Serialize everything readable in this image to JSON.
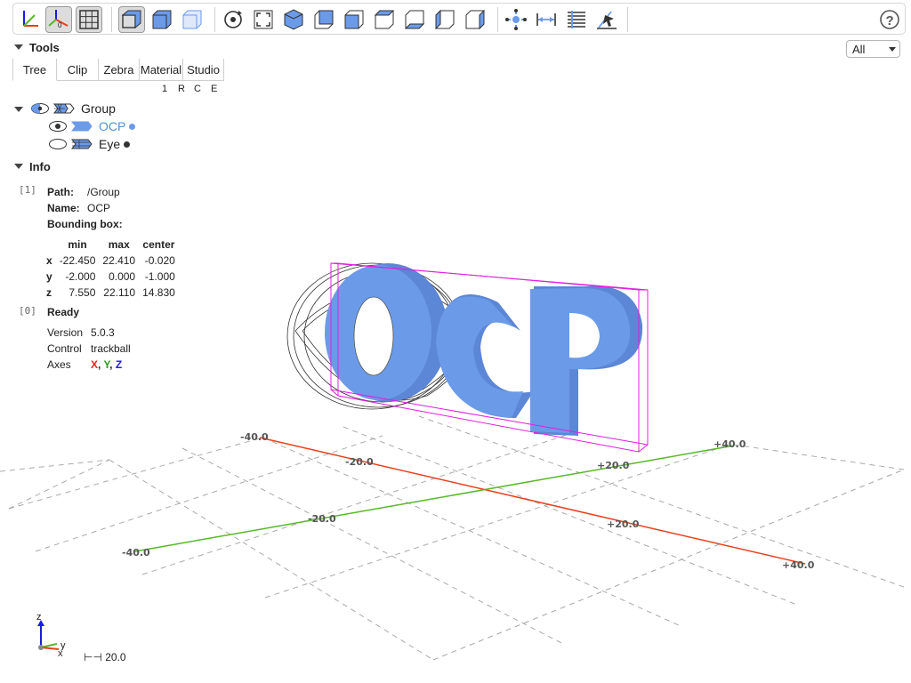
{
  "toolbar": {
    "buttons": [
      "axes",
      "axes0",
      "grid",
      "perspective",
      "ortho-cube",
      "transparent",
      "reset",
      "resize",
      "iso",
      "front",
      "rear",
      "top",
      "bottom",
      "left",
      "right",
      "explode",
      "measure-distance",
      "measure-properties",
      "select",
      "help"
    ],
    "active": [
      "axes0",
      "grid",
      "perspective"
    ]
  },
  "filter": {
    "value": "All"
  },
  "tools": {
    "title": "Tools",
    "tabs": [
      "Tree",
      "Clip",
      "Zebra",
      "Material",
      "Studio"
    ],
    "active_tab": "Tree",
    "tree_options": [
      "1",
      "R",
      "C",
      "E"
    ]
  },
  "tree": {
    "group": {
      "label": "Group"
    },
    "items": [
      {
        "label": "OCP",
        "color": "#6b9ae8",
        "selected": true
      },
      {
        "label": "Eye",
        "color": "#333333",
        "selected": false
      }
    ]
  },
  "info": {
    "title": "Info",
    "entry1": {
      "index": "[1]",
      "path_label": "Path:",
      "path": "/Group",
      "name_label": "Name:",
      "name": "OCP",
      "bbox_label": "Bounding box:",
      "headers": [
        "min",
        "max",
        "center"
      ],
      "rows": [
        {
          "axis": "x",
          "min": "-22.450",
          "max": "22.410",
          "center": "-0.020"
        },
        {
          "axis": "y",
          "min": "-2.000",
          "max": "0.000",
          "center": "-1.000"
        },
        {
          "axis": "z",
          "min": "7.550",
          "max": "22.110",
          "center": "14.830"
        }
      ]
    },
    "entry0": {
      "index": "[0]",
      "status": "Ready",
      "version_label": "Version",
      "version": "5.0.3",
      "control_label": "Control",
      "control": "trackball",
      "axes_label": "Axes",
      "axis_x": "X",
      "axis_y": "Y",
      "axis_z": "Z",
      "axis_sep": ", "
    }
  },
  "viewport": {
    "ticks": {
      "x_axis": [
        "-40.0",
        "-20.0",
        "+20.0",
        "+40.0"
      ],
      "y_axis": [
        "-40.0",
        "-20.0",
        "+20.0",
        "+40.0"
      ]
    },
    "model_text": "OCP",
    "axis_colors": {
      "x": "#e8401c",
      "y": "#56b828",
      "z": "#1a1ae6"
    },
    "bbox_color": "#e020e0",
    "model_color": "#6b9ae8",
    "mini_axes": {
      "z": "z",
      "y": "y",
      "x": "x"
    },
    "scale": "20.0"
  },
  "colors": {
    "accent": "#6b9ae8",
    "selection": "#4a90d9"
  }
}
